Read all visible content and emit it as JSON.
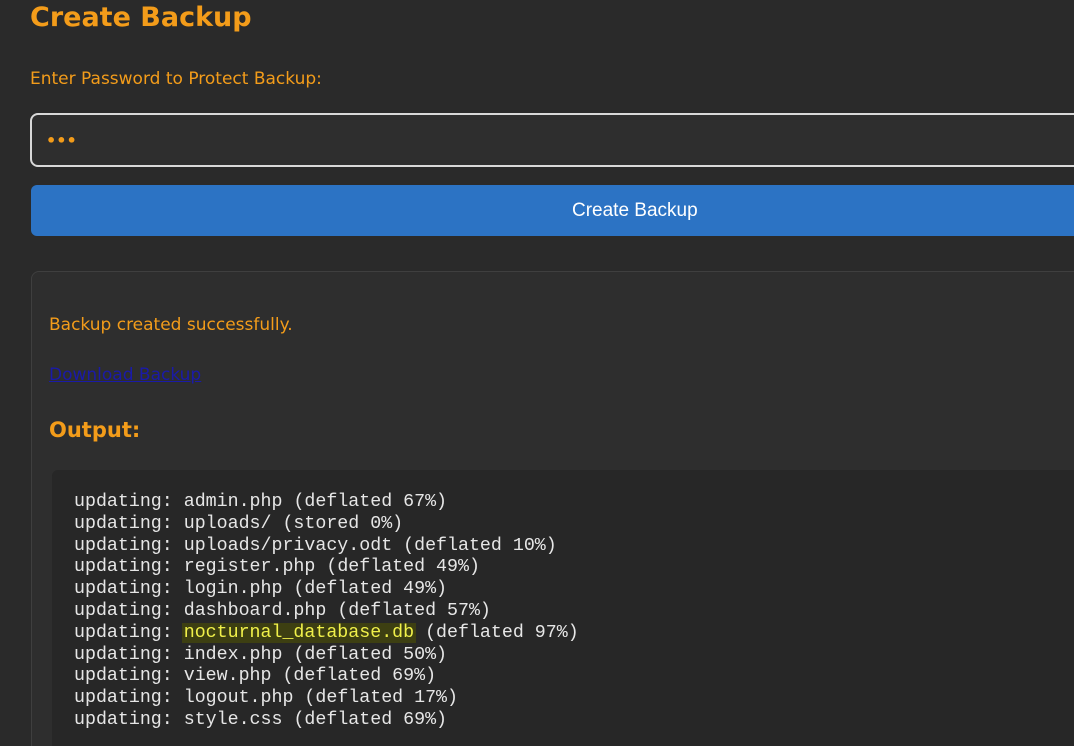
{
  "page": {
    "title": "Create Backup",
    "password_label": "Enter Password to Protect Backup:",
    "password_value": "•••",
    "create_button_label": "Create Backup"
  },
  "result": {
    "success_message": "Backup created successfully.",
    "download_link_label": "Download Backup",
    "output_heading": "Output:",
    "output_lines": [
      {
        "prefix": "updating: ",
        "file": "admin.php",
        "suffix": " (deflated 67%)"
      },
      {
        "prefix": "updating: ",
        "file": "uploads/",
        "suffix": " (stored 0%)"
      },
      {
        "prefix": "updating: ",
        "file": "uploads/privacy.odt",
        "suffix": " (deflated 10%)"
      },
      {
        "prefix": "updating: ",
        "file": "register.php",
        "suffix": " (deflated 49%)"
      },
      {
        "prefix": "updating: ",
        "file": "login.php",
        "suffix": " (deflated 49%)"
      },
      {
        "prefix": "updating: ",
        "file": "dashboard.php",
        "suffix": " (deflated 57%)"
      },
      {
        "prefix": "updating: ",
        "file": "nocturnal_database.db",
        "suffix": " (deflated 97%)",
        "highlighted": true
      },
      {
        "prefix": "updating: ",
        "file": "index.php",
        "suffix": " (deflated 50%)"
      },
      {
        "prefix": "updating: ",
        "file": "view.php",
        "suffix": " (deflated 69%)"
      },
      {
        "prefix": "updating: ",
        "file": "logout.php",
        "suffix": " (deflated 17%)"
      },
      {
        "prefix": "updating: ",
        "file": "style.css",
        "suffix": " (deflated 69%)"
      }
    ]
  },
  "colors": {
    "accent": "#f39c1a",
    "button": "#2c73c4",
    "background": "#2a2a2a",
    "highlight_bg": "#3d3f12",
    "highlight_text": "#f0f04a"
  }
}
